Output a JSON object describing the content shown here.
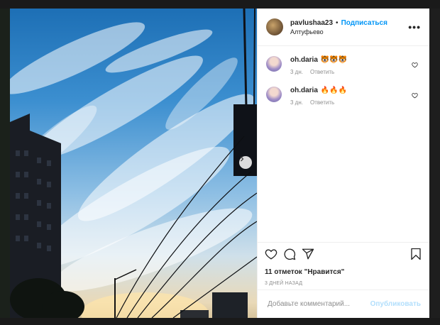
{
  "post": {
    "username": "pavlushaa23",
    "separator": "•",
    "follow_label": "Подписаться",
    "location": "Алтуфьево",
    "more_label": "•••"
  },
  "comments": [
    {
      "username": "oh.daria",
      "text": "🐯🐯🐯",
      "time": "3 дн.",
      "reply_label": "Ответить"
    },
    {
      "username": "oh.daria",
      "text": "🔥🔥🔥",
      "time": "3 дн.",
      "reply_label": "Ответить"
    }
  ],
  "stats": {
    "likes": "11 отметок \"Нравится\"",
    "date": "3 ДНЕЙ НАЗАД"
  },
  "add_comment": {
    "placeholder": "Добавьте комментарий...",
    "publish_label": "Опубликовать"
  },
  "colors": {
    "accent": "#0095f6",
    "publish_disabled": "#b2dffc",
    "text": "#262626",
    "muted": "#8e8e8e"
  },
  "icons": [
    "heart-icon",
    "comment-icon",
    "share-icon",
    "bookmark-icon",
    "chevron-right-icon",
    "more-icon"
  ]
}
